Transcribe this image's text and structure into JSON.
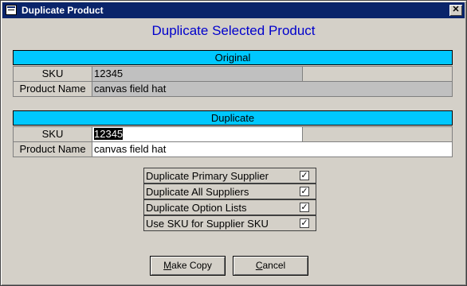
{
  "window": {
    "title": "Duplicate Product",
    "close_glyph": "✕"
  },
  "heading": "Duplicate Selected Product",
  "original": {
    "header": "Original",
    "sku_label": "SKU",
    "sku_value": "12345",
    "name_label": "Product Name",
    "name_value": "canvas field hat"
  },
  "duplicate": {
    "header": "Duplicate",
    "sku_label": "SKU",
    "sku_value": "12345",
    "name_label": "Product Name",
    "name_value": "canvas field hat"
  },
  "options": [
    {
      "label": "Duplicate Primary Supplier",
      "checked": "✓"
    },
    {
      "label": "Duplicate All Suppliers",
      "checked": "✓"
    },
    {
      "label": "Duplicate Option Lists",
      "checked": "✓"
    },
    {
      "label": "Use SKU for Supplier SKU",
      "checked": "✓"
    }
  ],
  "buttons": {
    "make_copy_accel": "M",
    "make_copy_rest": "ake Copy",
    "cancel_accel": "C",
    "cancel_rest": "ancel"
  }
}
